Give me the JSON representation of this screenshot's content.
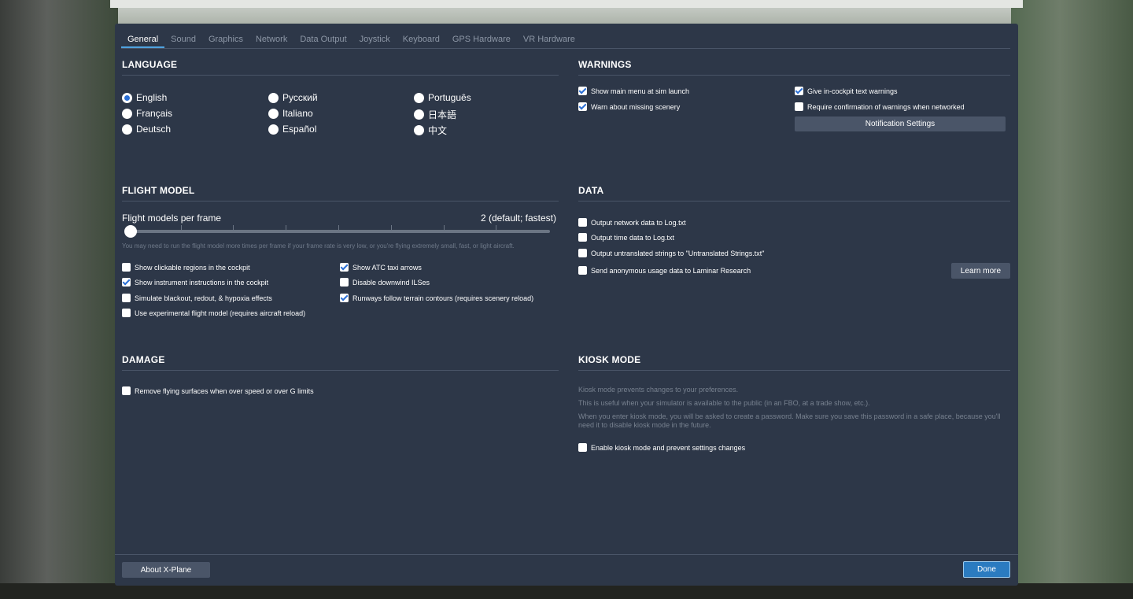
{
  "tabs": [
    "General",
    "Sound",
    "Graphics",
    "Network",
    "Data Output",
    "Joystick",
    "Keyboard",
    "GPS Hardware",
    "VR Hardware"
  ],
  "language": {
    "title": "LANGUAGE",
    "options": [
      "English",
      "Русский",
      "Português",
      "Français",
      "Italiano",
      "日本語",
      "Deutsch",
      "Español",
      "中文"
    ],
    "selected": "English"
  },
  "warnings": {
    "title": "WARNINGS",
    "items": [
      {
        "label": "Show main menu at sim launch",
        "checked": true
      },
      {
        "label": "Warn about missing scenery",
        "checked": true
      },
      {
        "label": "Give in-cockpit text warnings",
        "checked": true
      },
      {
        "label": "Require confirmation of warnings when networked",
        "checked": false
      }
    ],
    "notification_button": "Notification Settings"
  },
  "flight_model": {
    "title": "FLIGHT MODEL",
    "slider_label": "Flight models per frame",
    "slider_value": "2 (default; fastest)",
    "slider_level": 0,
    "hint": "You may need to run the flight model more times per frame if your frame rate is very low, or you're flying extremely small, fast, or light aircraft.",
    "items": [
      {
        "label": "Show clickable regions in the cockpit",
        "checked": false
      },
      {
        "label": "Show instrument instructions in the cockpit",
        "checked": true
      },
      {
        "label": "Simulate blackout, redout, & hypoxia effects",
        "checked": false
      },
      {
        "label": "Use experimental flight model (requires aircraft reload)",
        "checked": false
      },
      {
        "label": "Show ATC taxi arrows",
        "checked": true
      },
      {
        "label": "Disable downwind ILSes",
        "checked": false
      },
      {
        "label": "Runways follow terrain contours (requires scenery reload)",
        "checked": true
      }
    ]
  },
  "data": {
    "title": "DATA",
    "items": [
      {
        "label": "Output network data to Log.txt",
        "checked": false
      },
      {
        "label": "Output time data to Log.txt",
        "checked": false
      },
      {
        "label": "Output untranslated strings to \"Untranslated Strings.txt\"",
        "checked": false
      },
      {
        "label": "Send anonymous usage data to Laminar Research",
        "checked": false
      }
    ],
    "learn_more": "Learn more"
  },
  "damage": {
    "title": "DAMAGE",
    "items": [
      {
        "label": "Remove flying surfaces when over speed or over G limits",
        "checked": false
      }
    ]
  },
  "kiosk": {
    "title": "KIOSK MODE",
    "line1": "Kiosk mode prevents changes to your preferences.",
    "line2": "This is useful when your simulator is available to the public (in an FBO, at a trade show, etc.).",
    "line3": "When you enter kiosk mode, you will be asked to create a password. Make sure you save this password in a safe place, because you'll need it to disable kiosk mode in the future.",
    "enable": {
      "label": "Enable kiosk mode and prevent settings changes",
      "checked": false
    }
  },
  "footer": {
    "about": "About X-Plane",
    "done": "Done"
  },
  "colors": {
    "panel": "#2d3748",
    "accent": "#2b7bc0",
    "check": "#2a6fd6"
  }
}
